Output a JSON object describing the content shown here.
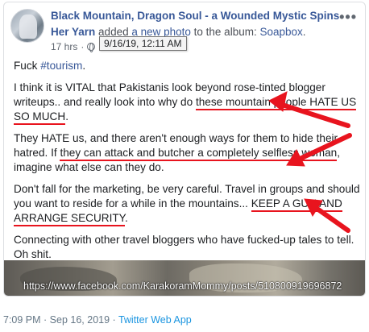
{
  "post": {
    "page_name": "Black Mountain, Dragon Soul - a Wounded Mystic Spins",
    "page_name_cont": "Her Yarn",
    "action_prefix": " added ",
    "action_link": "a new photo",
    "action_middle": " to the album: ",
    "album_name": "Soapbox",
    "album_suffix": ".",
    "time_ago": "17 hrs",
    "meta_sep": "·",
    "tooltip_date": "9/16/19, 12:11 AM",
    "more_label": "•••"
  },
  "body": {
    "p1_text": "Fuck ",
    "p1_hashtag": "#tourism",
    "p1_end": ".",
    "p2_pre": "I think it is VITAL that Pakistanis look beyond rose-tinted blogger writeups.. and really look into why do ",
    "p2_ul": "these mountain people HATE US SO MUCH",
    "p2_end": ".",
    "p3_pre": "They HATE us, and there aren't enough ways for them to hide their hatred. If ",
    "p3_ul": "they can attack and butcher a completely selfless woman",
    "p3_end": ", imagine what else can they do.",
    "p4_pre": "Don't fall for the marketing, be very careful. Travel in groups and should you want to reside for a while in the mountains... ",
    "p4_ul": "KEEP A GUN AND ARRANGE SECURITY",
    "p4_end": ".",
    "p5": "Connecting with other travel bloggers who have fucked-up tales to tell. Oh shit."
  },
  "image": {
    "url_text": "https://www.facebook.com/KarakoramMommy/posts/510800919696872"
  },
  "tweet": {
    "time": "7:09 PM",
    "sep": " · ",
    "date": "Sep 16, 2019",
    "source": "Twitter Web App"
  },
  "colors": {
    "link": "#385898",
    "annotation_red": "#e8141e",
    "twitter_blue": "#1b95e0",
    "muted": "#657786"
  }
}
